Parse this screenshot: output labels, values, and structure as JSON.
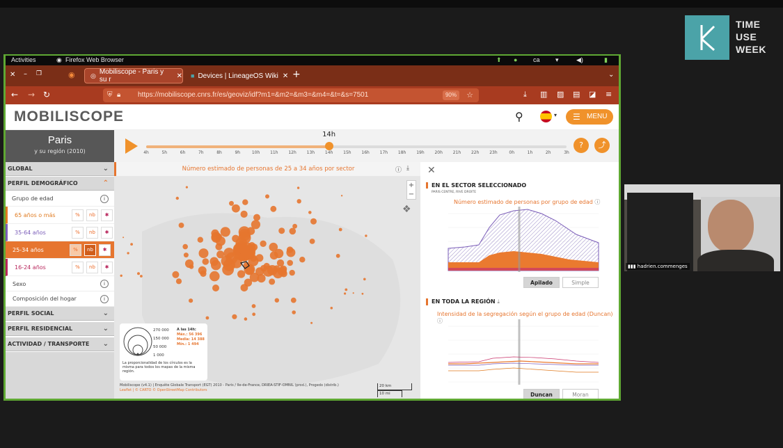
{
  "logo": {
    "lines": [
      "TIME",
      "USE",
      "WEEK"
    ]
  },
  "gnome": {
    "activities": "Activities",
    "app": "Firefox Web Browser",
    "lang": "ca"
  },
  "tabs": [
    {
      "label": "Mobiliscope - Paris y su r"
    },
    {
      "label": "Devices | LineageOS Wiki"
    }
  ],
  "url": {
    "value": "https://mobiliscope.cnrs.fr/es/geoviz/idf?m1=&m2=&m3=&m4=&t=&s=7501",
    "zoom": "90%"
  },
  "site": {
    "brand": "MOBILISCOPE",
    "menu": "MENU"
  },
  "sidebar": {
    "city": "Paris",
    "subtitle": "y su región (2010)",
    "global": "GLOBAL",
    "perfil_demografico": "PERFIL DEMOGRÁFICO",
    "grupo_edad": "Grupo de edad",
    "ages": [
      {
        "label": "65 años o más",
        "color": "#e07a1f"
      },
      {
        "label": "35-64 años",
        "color": "#7a5cb8"
      },
      {
        "label": "25-34 años",
        "color": "#ffffff"
      },
      {
        "label": "16-24 años",
        "color": "#b8255b"
      }
    ],
    "btn_pct": "%",
    "btn_nb": "nb",
    "btn_star": "✱",
    "sexo": "Sexo",
    "hogar": "Composición del hogar",
    "perfil_social": "PERFIL SOCIAL",
    "perfil_residencial": "PERFIL RESIDENCIAL",
    "actividad": "ACTIVIDAD / TRANSPORTE"
  },
  "timeline": {
    "current": "14h",
    "hours": [
      "4h",
      "5h",
      "6h",
      "7h",
      "8h",
      "9h",
      "10h",
      "11h",
      "12h",
      "13h",
      "14h",
      "15h",
      "16h",
      "17h",
      "18h",
      "19h",
      "20h",
      "21h",
      "22h",
      "23h",
      "0h",
      "1h",
      "2h",
      "3h"
    ],
    "current_index": 10
  },
  "map": {
    "title": "Número estimado de personas de 25 a 34 años por sector",
    "legend_values": [
      "270 000",
      "150 000",
      "50 000",
      "1 000"
    ],
    "legend_head": "A las 14h:",
    "legend_max": "Máx.: 56 396",
    "legend_mean": "Media: 14 388",
    "legend_min": "Mín.: 1 494",
    "legend_note": "La proporcionalidad de los círculos es la misma para todos los mapas de la misma región.",
    "credits": "Mobiliscope (v4.1) | Enquête Globale Transport (EGT) 2010 - Paris / Ile-de-France, DRIEA-STIF-OMNIL (prod.), Progedo (distrib.)",
    "credits2": "Leaflet | © CARTO © OpenStreetMap Contributors",
    "scale_km": "20 km",
    "scale_mi": "10 mi"
  },
  "right": {
    "sector_head": "EN EL SECTOR SELECCIONADO",
    "sector_sub": "PARIS CENTRE, RIVE DROITE",
    "sector_chart_title": "Número estimado de personas por grupo de edad",
    "btn_apilado": "Apilado",
    "btn_simple": "Simple",
    "region_head": "EN TODA LA REGIÓN",
    "region_chart_title": "Intensidad de la segregación según el grupo de edad (Duncan)",
    "btn_duncan": "Duncan",
    "btn_moran": "Moran"
  },
  "webcam": {
    "name": "hadrien.commenges"
  },
  "colors": {
    "orange": "#f0922b",
    "purple": "#7a5cb8",
    "red": "#b8255b"
  }
}
